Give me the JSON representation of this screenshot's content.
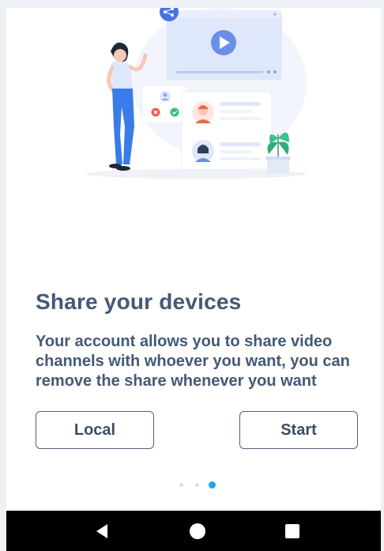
{
  "onboarding": {
    "title": "Share your devices",
    "description": "Your account allows you to share video channels with whoever you want, you can remove the share whenever you want",
    "local_button": "Local",
    "start_button": "Start",
    "page_indicator": {
      "total": 3,
      "current": 3
    }
  },
  "illustration": {
    "icons": [
      "share-icon",
      "play-icon",
      "user-icon",
      "reject-icon",
      "accept-icon",
      "plant-icon"
    ]
  },
  "navbar": {
    "icons": [
      "back-icon",
      "home-icon",
      "recent-apps-icon"
    ]
  },
  "colors": {
    "text": "#445977",
    "button_border": "#4f6178",
    "indicator_active": "#1aa6e9",
    "indicator_inactive": "#dbe1e8",
    "accent_blue": "#6b8fe6"
  }
}
